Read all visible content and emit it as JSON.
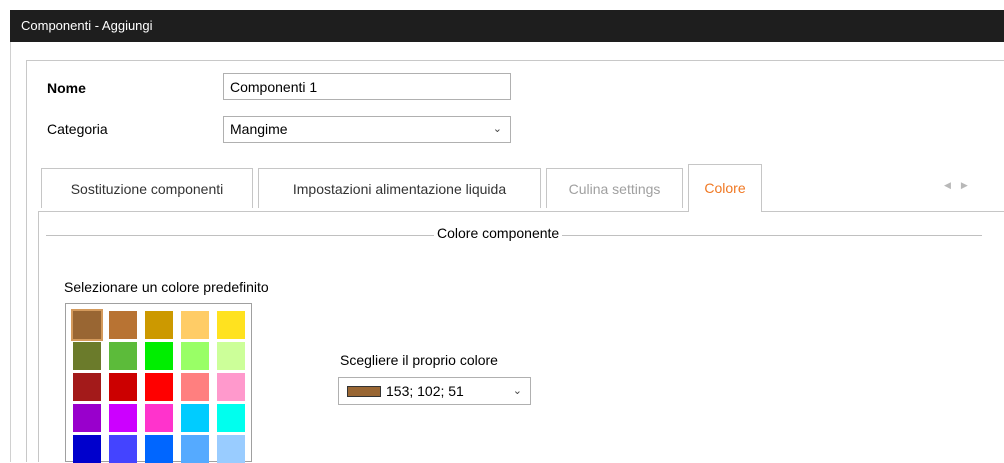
{
  "window": {
    "title": "Componenti - Aggiungi"
  },
  "form": {
    "name_label": "Nome",
    "name_value": "Componenti 1",
    "category_label": "Categoria",
    "category_value": "Mangime"
  },
  "tabs": [
    {
      "label": "Sostituzione componenti",
      "state": "normal"
    },
    {
      "label": "Impostazioni alimentazione liquida",
      "state": "normal"
    },
    {
      "label": "Culina settings",
      "state": "disabled"
    },
    {
      "label": "Colore",
      "state": "active"
    }
  ],
  "colore": {
    "section_title": "Colore componente",
    "palette_label": "Selezionare un colore predefinito",
    "own_color_label": "Scegliere il proprio colore",
    "own_color_value": "153; 102; 51",
    "own_color_hex": "#996633",
    "palette": [
      [
        "#996633",
        "#b87333",
        "#cc9900",
        "#ffcc66",
        "#ffe21f"
      ],
      [
        "#6b7b2b",
        "#5cbb3a",
        "#00ee00",
        "#99ff66",
        "#ccff99"
      ],
      [
        "#a31a1a",
        "#cc0000",
        "#ff0000",
        "#ff7f7f",
        "#ff99cc"
      ],
      [
        "#9900cc",
        "#cc00ff",
        "#ff33cc",
        "#00ccff",
        "#00ffee"
      ],
      [
        "#0000cc",
        "#4444ff",
        "#0066ff",
        "#55aaff",
        "#99ccff"
      ]
    ]
  },
  "colors": {
    "title_bar": "#1e1e1e",
    "active_tab": "#f07823"
  }
}
